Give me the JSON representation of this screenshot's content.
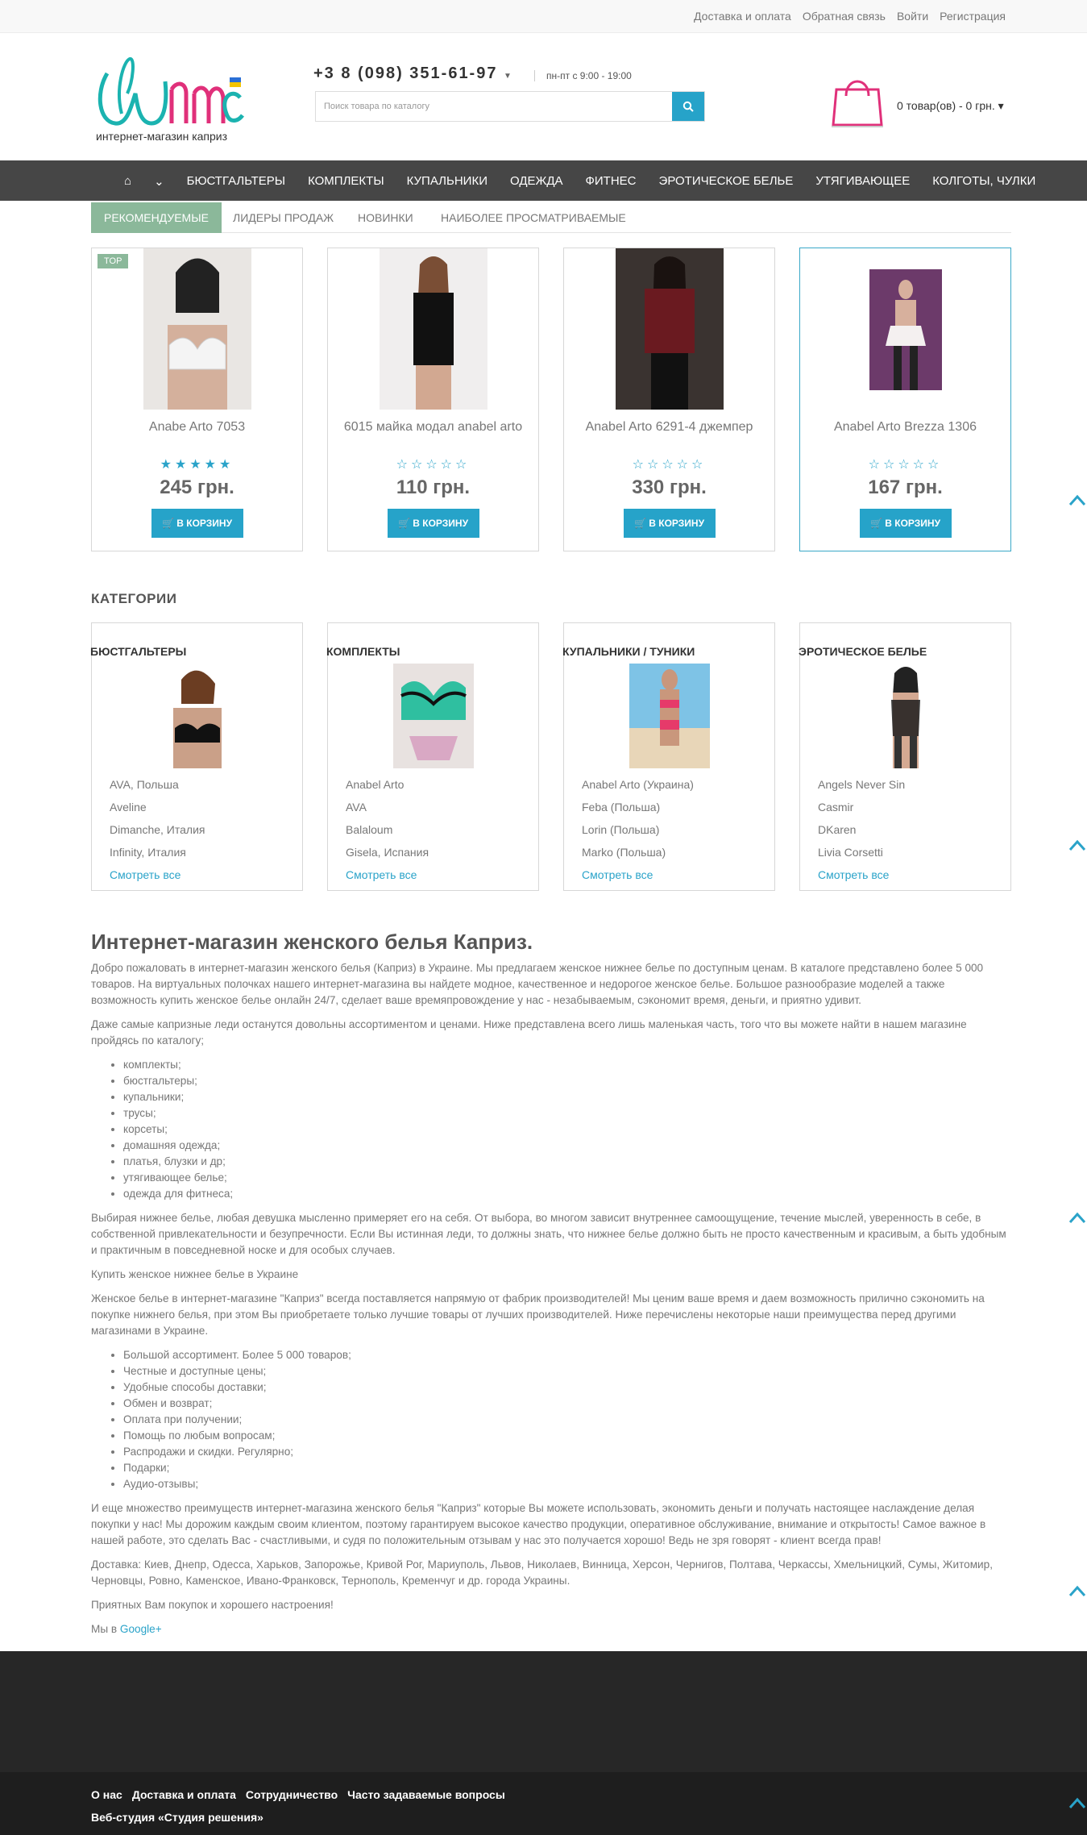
{
  "topbar": {
    "links": [
      "Доставка и оплата",
      "Обратная связь",
      "Войти",
      "Регистрация"
    ]
  },
  "header": {
    "logo_tagline": "интернет-магазин каприз",
    "phone": "+3 8 (098) 351-61-97",
    "hours": "пн-пт с 9:00 - 19:00",
    "search_placeholder": "Поиск товара по каталогу",
    "cart_text": "0 товар(ов) - 0 грн."
  },
  "nav": {
    "items": [
      "БЮСТГАЛЬТЕРЫ",
      "КОМПЛЕКТЫ",
      "КУПАЛЬНИКИ",
      "ОДЕЖДА",
      "ФИТНЕС",
      "ЭРОТИЧЕСКОЕ БЕЛЬЕ",
      "УТЯГИВАЮЩЕЕ",
      "КОЛГОТЫ, ЧУЛКИ"
    ]
  },
  "tabs": [
    "РЕКОМЕНДУЕМЫЕ",
    "ЛИДЕРЫ ПРОДАЖ",
    "НОВИНКИ",
    "НАИБОЛЕЕ ПРОСМАТРИВАЕМЫЕ"
  ],
  "products": [
    {
      "name": "Anabe Arto 7053",
      "price": "245 грн.",
      "rating": 5,
      "badge": "TOP",
      "button": "В КОРЗИНУ"
    },
    {
      "name": "6015 майка модал anabel arto",
      "price": "110 грн.",
      "rating": 0,
      "button": "В КОРЗИНУ"
    },
    {
      "name": "Anabel Arto 6291-4 джемпер",
      "price": "330 грн.",
      "rating": 0,
      "button": "В КОРЗИНУ"
    },
    {
      "name": "Anabel Arto Brezza 1306",
      "price": "167 грн.",
      "rating": 0,
      "button": "В КОРЗИНУ"
    }
  ],
  "categories_title": "КАТЕГОРИИ",
  "categories": [
    {
      "title": "БЮСТГАЛЬТЕРЫ",
      "items": [
        "AVA, Польша",
        "Aveline",
        "Dimanche, Италия",
        "Infinity, Италия"
      ],
      "more": "Смотреть все"
    },
    {
      "title": "КОМПЛЕКТЫ",
      "items": [
        "Anabel Arto",
        "AVA",
        "Balaloum",
        "Gisela, Испания"
      ],
      "more": "Смотреть все"
    },
    {
      "title": "КУПАЛЬНИКИ / ТУНИКИ",
      "items": [
        "Anabel Arto (Украина)",
        "Feba (Польша)",
        "Lorin (Польша)",
        "Marko (Польша)"
      ],
      "more": "Смотреть все"
    },
    {
      "title": "ЭРОТИЧЕСКОЕ БЕЛЬЕ",
      "items": [
        "Angels Never Sin",
        "Casmir",
        "DKaren",
        "Livia Corsetti"
      ],
      "more": "Смотреть все"
    }
  ],
  "seo": {
    "title": "Интернет-магазин женского белья Каприз.",
    "p1": "Добро пожаловать в интернет-магазин женского белья (Каприз) в Украине. Мы предлагаем женское нижнее белье по доступным ценам. В каталоге представлено более 5 000 товаров. На виртуальных полочках нашего интернет-магазина вы найдете модное, качественное и недорогое женское белье. Большое разнообразие моделей а также возможность купить женское белье онлайн 24/7, сделает ваше времяпровождение у нас - незабываемым, сэкономит время, деньги, и приятно удивит.",
    "p2": "Даже самые капризные леди останутся довольны ассортиментом и ценами. Ниже представлена всего лишь маленькая часть, того что вы можете найти в нашем магазине пройдясь по каталогу;",
    "list1": [
      "комплекты;",
      "бюстгальтеры;",
      "купальники;",
      "трусы;",
      "корсеты;",
      "домашняя одежда;",
      "платья, блузки и др;",
      "утягивающее белье;",
      "одежда для фитнеса;"
    ],
    "p3": "Выбирая нижнее белье, любая девушка мысленно примеряет его на себя. От выбора, во многом зависит внутреннее самоощущение, течение мыслей, уверенность в себе, в собственной привлекательности и безупречности. Если Вы истинная леди, то должны знать, что нижнее белье должно быть не просто качественным и красивым, а быть удобным и практичным в повседневной носке и для особых случаев.",
    "p4": "Купить женское нижнее белье в Украине",
    "p5": "Женское белье в интернет-магазине \"Каприз\" всегда поставляется напрямую от фабрик производителей! Мы ценим ваше время и даем возможность прилично сэкономить на покупке нижнего белья, при этом Вы приобретаете только лучшие товары от лучших производителей. Ниже перечислены некоторые наши преимущества перед другими магазинами в Украине.",
    "list2": [
      "Большой ассортимент. Более 5 000 товаров;",
      "Честные и доступные цены;",
      "Удобные способы доставки;",
      "Обмен и возврат;",
      "Оплата при получении;",
      "Помощь по любым вопросам;",
      "Распродажи и скидки. Регулярно;",
      "Подарки;",
      "Аудио-отзывы;"
    ],
    "p6": "И еще множество преимуществ интернет-магазина женского белья \"Каприз\" которые Вы можете использовать, экономить деньги и получать настоящее наслаждение делая покупки у нас! Мы дорожим каждым своим клиентом, поэтому гарантируем высокое качество продукции, оперативное обслуживание, внимание и открытость! Самое важное в нашей работе, это сделать Вас - счастливыми, и судя по положительным отзывам у нас это получается хорошо! Ведь не зря говорят - клиент всегда прав!",
    "p7": "Доставка: Киев, Днепр, Одесса, Харьков, Запорожье, Кривой Рог, Мариуполь, Львов, Николаев, Винница, Херсон, Чернигов, Полтава, Черкассы, Хмельницкий, Сумы, Житомир, Черновцы, Ровно, Каменское, Ивано-Франковск, Тернополь, Кременчуг и др. города Украины.",
    "p8": "Приятных Вам покупок и хорошего настроения!",
    "p9_prefix": "Мы в",
    "p9_link": "Google+"
  },
  "footer": {
    "links": [
      "О нас",
      "Доставка и оплата",
      "Сотрудничество",
      "Часто задаваемые вопросы"
    ],
    "studio": "Веб-студия «Студия решения»"
  }
}
